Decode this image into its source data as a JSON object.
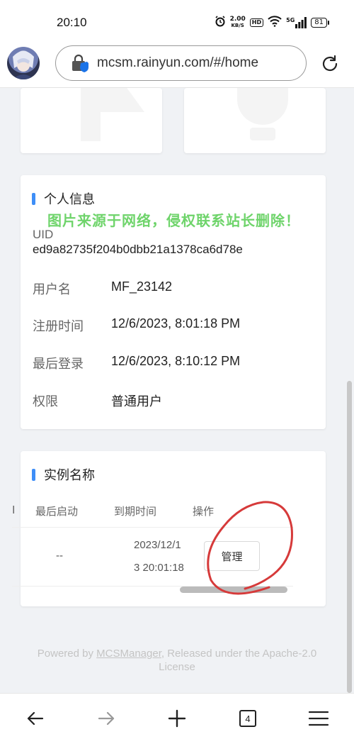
{
  "status_bar": {
    "time": "20:10",
    "net_speed_value": "2.00",
    "net_speed_unit": "KB/S",
    "hd_badge": "HD",
    "signal_label": "5G",
    "battery": "81"
  },
  "browser": {
    "url": "mcsm.rainyun.com/#/home",
    "tab_count": "4"
  },
  "watermark": "图片来源于网络，侵权联系站长删除！",
  "info_card": {
    "title": "个人信息",
    "uid_label": "UID",
    "uid_value": "ed9a82735f204b0dbb21a1378ca6d78e",
    "rows": [
      {
        "label": "用户名",
        "value": "MF_23142"
      },
      {
        "label": "注册时间",
        "value": "12/6/2023, 8:01:18 PM"
      },
      {
        "label": "最后登录",
        "value": "12/6/2023, 8:10:12 PM"
      },
      {
        "label": "权限",
        "value": "普通用户"
      }
    ]
  },
  "instances_card": {
    "title": "实例名称",
    "partial_header": "Ⅰ",
    "headers": [
      "最后启动",
      "到期时间",
      "操作"
    ],
    "row": {
      "last_start": "--",
      "expire_line1": "2023/12/1",
      "expire_line2": "3 20:01:18",
      "action": "管理"
    }
  },
  "footer": {
    "prefix": "Powered by ",
    "link": "MCSManager",
    "suffix": ", Released under the Apache-2.0",
    "line2": "License"
  },
  "colors": {
    "accent": "#3e8ef7",
    "watermark": "#6fd46b",
    "annotation": "#d63a3a",
    "page_bg": "#f0f2f5"
  },
  "icons": [
    "alarm-icon",
    "wifi-icon",
    "signal-icon",
    "lock-icon",
    "reload-icon",
    "back-icon",
    "forward-icon",
    "new-tab-icon",
    "tabs-icon",
    "menu-icon"
  ]
}
